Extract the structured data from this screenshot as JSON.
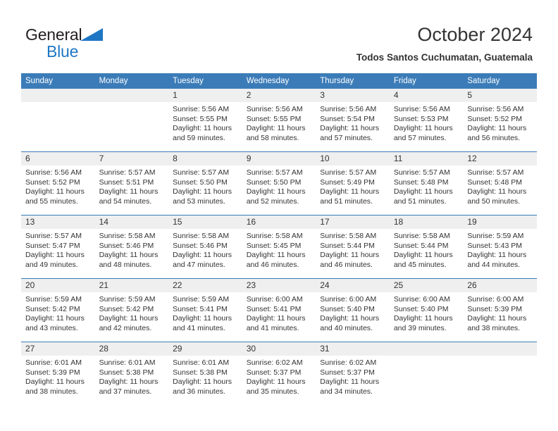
{
  "brand": {
    "line1": "General",
    "line2": "Blue",
    "triangle_color": "#1f77c4",
    "text_color": "#231f20"
  },
  "header": {
    "title": "October 2024",
    "subtitle": "Todos Santos Cuchumatan, Guatemala"
  },
  "theme": {
    "header_row_bg": "#3b7cb8",
    "header_row_text": "#ffffff",
    "date_strip_bg": "#efefef",
    "cell_bg": "#ffffff",
    "grid_line": "#3b7cb8",
    "body_text": "#333333"
  },
  "weekday_headers": [
    "Sunday",
    "Monday",
    "Tuesday",
    "Wednesday",
    "Thursday",
    "Friday",
    "Saturday"
  ],
  "labels": {
    "sunrise_prefix": "Sunrise:",
    "sunset_prefix": "Sunset:",
    "daylight_prefix": "Daylight:"
  },
  "weeks": [
    [
      {
        "date": "",
        "sunrise": "",
        "sunset": "",
        "daylight": "",
        "empty": true
      },
      {
        "date": "",
        "sunrise": "",
        "sunset": "",
        "daylight": "",
        "empty": true
      },
      {
        "date": "1",
        "sunrise": "Sunrise: 5:56 AM",
        "sunset": "Sunset: 5:55 PM",
        "daylight": "Daylight: 11 hours and 59 minutes.",
        "empty": false
      },
      {
        "date": "2",
        "sunrise": "Sunrise: 5:56 AM",
        "sunset": "Sunset: 5:55 PM",
        "daylight": "Daylight: 11 hours and 58 minutes.",
        "empty": false
      },
      {
        "date": "3",
        "sunrise": "Sunrise: 5:56 AM",
        "sunset": "Sunset: 5:54 PM",
        "daylight": "Daylight: 11 hours and 57 minutes.",
        "empty": false
      },
      {
        "date": "4",
        "sunrise": "Sunrise: 5:56 AM",
        "sunset": "Sunset: 5:53 PM",
        "daylight": "Daylight: 11 hours and 57 minutes.",
        "empty": false
      },
      {
        "date": "5",
        "sunrise": "Sunrise: 5:56 AM",
        "sunset": "Sunset: 5:52 PM",
        "daylight": "Daylight: 11 hours and 56 minutes.",
        "empty": false
      }
    ],
    [
      {
        "date": "6",
        "sunrise": "Sunrise: 5:56 AM",
        "sunset": "Sunset: 5:52 PM",
        "daylight": "Daylight: 11 hours and 55 minutes.",
        "empty": false
      },
      {
        "date": "7",
        "sunrise": "Sunrise: 5:57 AM",
        "sunset": "Sunset: 5:51 PM",
        "daylight": "Daylight: 11 hours and 54 minutes.",
        "empty": false
      },
      {
        "date": "8",
        "sunrise": "Sunrise: 5:57 AM",
        "sunset": "Sunset: 5:50 PM",
        "daylight": "Daylight: 11 hours and 53 minutes.",
        "empty": false
      },
      {
        "date": "9",
        "sunrise": "Sunrise: 5:57 AM",
        "sunset": "Sunset: 5:50 PM",
        "daylight": "Daylight: 11 hours and 52 minutes.",
        "empty": false
      },
      {
        "date": "10",
        "sunrise": "Sunrise: 5:57 AM",
        "sunset": "Sunset: 5:49 PM",
        "daylight": "Daylight: 11 hours and 51 minutes.",
        "empty": false
      },
      {
        "date": "11",
        "sunrise": "Sunrise: 5:57 AM",
        "sunset": "Sunset: 5:48 PM",
        "daylight": "Daylight: 11 hours and 51 minutes.",
        "empty": false
      },
      {
        "date": "12",
        "sunrise": "Sunrise: 5:57 AM",
        "sunset": "Sunset: 5:48 PM",
        "daylight": "Daylight: 11 hours and 50 minutes.",
        "empty": false
      }
    ],
    [
      {
        "date": "13",
        "sunrise": "Sunrise: 5:57 AM",
        "sunset": "Sunset: 5:47 PM",
        "daylight": "Daylight: 11 hours and 49 minutes.",
        "empty": false
      },
      {
        "date": "14",
        "sunrise": "Sunrise: 5:58 AM",
        "sunset": "Sunset: 5:46 PM",
        "daylight": "Daylight: 11 hours and 48 minutes.",
        "empty": false
      },
      {
        "date": "15",
        "sunrise": "Sunrise: 5:58 AM",
        "sunset": "Sunset: 5:46 PM",
        "daylight": "Daylight: 11 hours and 47 minutes.",
        "empty": false
      },
      {
        "date": "16",
        "sunrise": "Sunrise: 5:58 AM",
        "sunset": "Sunset: 5:45 PM",
        "daylight": "Daylight: 11 hours and 46 minutes.",
        "empty": false
      },
      {
        "date": "17",
        "sunrise": "Sunrise: 5:58 AM",
        "sunset": "Sunset: 5:44 PM",
        "daylight": "Daylight: 11 hours and 46 minutes.",
        "empty": false
      },
      {
        "date": "18",
        "sunrise": "Sunrise: 5:58 AM",
        "sunset": "Sunset: 5:44 PM",
        "daylight": "Daylight: 11 hours and 45 minutes.",
        "empty": false
      },
      {
        "date": "19",
        "sunrise": "Sunrise: 5:59 AM",
        "sunset": "Sunset: 5:43 PM",
        "daylight": "Daylight: 11 hours and 44 minutes.",
        "empty": false
      }
    ],
    [
      {
        "date": "20",
        "sunrise": "Sunrise: 5:59 AM",
        "sunset": "Sunset: 5:42 PM",
        "daylight": "Daylight: 11 hours and 43 minutes.",
        "empty": false
      },
      {
        "date": "21",
        "sunrise": "Sunrise: 5:59 AM",
        "sunset": "Sunset: 5:42 PM",
        "daylight": "Daylight: 11 hours and 42 minutes.",
        "empty": false
      },
      {
        "date": "22",
        "sunrise": "Sunrise: 5:59 AM",
        "sunset": "Sunset: 5:41 PM",
        "daylight": "Daylight: 11 hours and 41 minutes.",
        "empty": false
      },
      {
        "date": "23",
        "sunrise": "Sunrise: 6:00 AM",
        "sunset": "Sunset: 5:41 PM",
        "daylight": "Daylight: 11 hours and 41 minutes.",
        "empty": false
      },
      {
        "date": "24",
        "sunrise": "Sunrise: 6:00 AM",
        "sunset": "Sunset: 5:40 PM",
        "daylight": "Daylight: 11 hours and 40 minutes.",
        "empty": false
      },
      {
        "date": "25",
        "sunrise": "Sunrise: 6:00 AM",
        "sunset": "Sunset: 5:40 PM",
        "daylight": "Daylight: 11 hours and 39 minutes.",
        "empty": false
      },
      {
        "date": "26",
        "sunrise": "Sunrise: 6:00 AM",
        "sunset": "Sunset: 5:39 PM",
        "daylight": "Daylight: 11 hours and 38 minutes.",
        "empty": false
      }
    ],
    [
      {
        "date": "27",
        "sunrise": "Sunrise: 6:01 AM",
        "sunset": "Sunset: 5:39 PM",
        "daylight": "Daylight: 11 hours and 38 minutes.",
        "empty": false
      },
      {
        "date": "28",
        "sunrise": "Sunrise: 6:01 AM",
        "sunset": "Sunset: 5:38 PM",
        "daylight": "Daylight: 11 hours and 37 minutes.",
        "empty": false
      },
      {
        "date": "29",
        "sunrise": "Sunrise: 6:01 AM",
        "sunset": "Sunset: 5:38 PM",
        "daylight": "Daylight: 11 hours and 36 minutes.",
        "empty": false
      },
      {
        "date": "30",
        "sunrise": "Sunrise: 6:02 AM",
        "sunset": "Sunset: 5:37 PM",
        "daylight": "Daylight: 11 hours and 35 minutes.",
        "empty": false
      },
      {
        "date": "31",
        "sunrise": "Sunrise: 6:02 AM",
        "sunset": "Sunset: 5:37 PM",
        "daylight": "Daylight: 11 hours and 34 minutes.",
        "empty": false
      },
      {
        "date": "",
        "sunrise": "",
        "sunset": "",
        "daylight": "",
        "empty": true
      },
      {
        "date": "",
        "sunrise": "",
        "sunset": "",
        "daylight": "",
        "empty": true
      }
    ]
  ]
}
